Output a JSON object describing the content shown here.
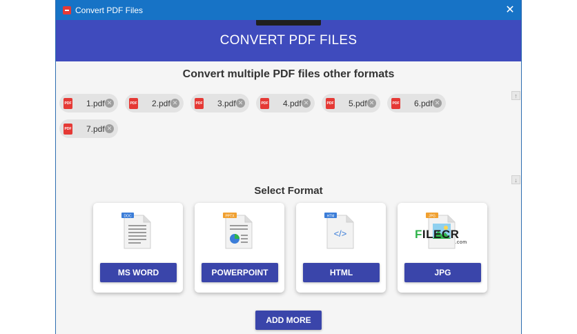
{
  "window": {
    "title": "Convert PDF Files",
    "close_glyph": "✕"
  },
  "header": {
    "title": "CONVERT PDF FILES"
  },
  "subtitle": "Convert multiple PDF files other formats",
  "files": [
    {
      "name": "1.pdf",
      "icon": "pdf-file-icon",
      "icon_text": "PDF"
    },
    {
      "name": "2.pdf",
      "icon": "pdf-file-icon",
      "icon_text": "PDF"
    },
    {
      "name": "3.pdf",
      "icon": "pdf-file-icon",
      "icon_text": "PDF"
    },
    {
      "name": "4.pdf",
      "icon": "pdf-file-icon",
      "icon_text": "PDF"
    },
    {
      "name": "5.pdf",
      "icon": "pdf-file-icon",
      "icon_text": "PDF"
    },
    {
      "name": "6.pdf",
      "icon": "pdf-file-icon",
      "icon_text": "PDF"
    },
    {
      "name": "7.pdf",
      "icon": "pdf-file-icon",
      "icon_text": "PDF"
    }
  ],
  "remove_glyph": "✕",
  "scroll": {
    "up_glyph": "↑",
    "down_glyph": "↓"
  },
  "format_section": {
    "title": "Select Format"
  },
  "formats": [
    {
      "label": "MS WORD",
      "tag": "DOC",
      "tag_color": "#3b7dd8",
      "icon": "doc-file-icon"
    },
    {
      "label": "POWERPOINT",
      "tag": "PPTX",
      "tag_color": "#f0a030",
      "icon": "pptx-file-icon"
    },
    {
      "label": "HTML",
      "tag": "HTM",
      "tag_color": "#3b7dd8",
      "icon": "html-file-icon"
    },
    {
      "label": "JPG",
      "tag": "JPG",
      "tag_color": "#f0a030",
      "icon": "jpg-file-icon"
    }
  ],
  "html_glyph": "</>",
  "add_more_label": "ADD MORE",
  "watermark": {
    "prefix": "F",
    "text": "ILECR",
    "suffix": ".com"
  },
  "colors": {
    "titlebar": "#1773c6",
    "header": "#3f4bbd",
    "button": "#3a45aa",
    "pdf_red": "#e53935"
  }
}
